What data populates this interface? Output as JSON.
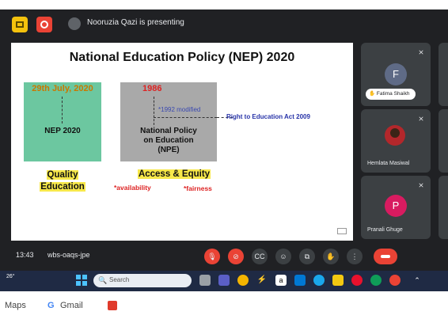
{
  "meeting": {
    "presenting_text": "Nooruzia Qazi is presenting",
    "time": "13:43",
    "meeting_code": "wbs-oaqs-jpe"
  },
  "slide": {
    "title": "National Education Policy (NEP) 2020",
    "green_date": "29th July, 2020",
    "green_label": "NEP 2020",
    "gray_year": "1986",
    "gray_modified": "*1992 modified",
    "gray_label_1": "National Policy",
    "gray_label_2": "on Education",
    "gray_label_3": "(NPE)",
    "rte": "Right to Education Act 2009",
    "quality_1": "Quality",
    "quality_2": "Education",
    "access": "Access & Equity",
    "availability": "*availability",
    "fairness": "*fairness"
  },
  "participants": [
    {
      "initial": "F",
      "name": "Fatima Shaikh",
      "avatar_color": "#5f6b86"
    },
    {
      "initial": "",
      "name": "Hemlata Masiwal",
      "avatar_color": "#b3272b"
    },
    {
      "initial": "P",
      "name": "Pranali Ghuge",
      "avatar_color": "#d81b60"
    }
  ],
  "controls": [
    "mic-off-icon",
    "camera-off-icon",
    "captions-icon",
    "emoji-icon",
    "present-icon",
    "raise-hand-icon",
    "more-icon",
    "end-call-icon"
  ],
  "taskbar": {
    "weather": "26°",
    "search_placeholder": "Search"
  },
  "bookmarks": [
    "Maps",
    "Gmail"
  ],
  "colors": {
    "meet_bg": "#202124",
    "tile_bg": "#3c4043",
    "end_call": "#ea4335",
    "highlight": "#f7e84a"
  }
}
